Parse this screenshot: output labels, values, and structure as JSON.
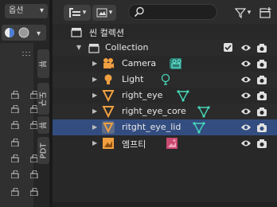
{
  "left_panel": {
    "options_label": "옵션",
    "tabs": [
      {
        "label": "뷰",
        "active": false
      },
      {
        "label": "도구",
        "active": false
      },
      {
        "label": "뷰",
        "active": false
      },
      {
        "label": "PDT",
        "active": false
      }
    ]
  },
  "outliner": {
    "scene_label": "씬 컬렉션",
    "rows": [
      {
        "name": "Collection",
        "type": "collection"
      },
      {
        "name": "Camera",
        "type": "camera"
      },
      {
        "name": "Light",
        "type": "light"
      },
      {
        "name": "right_eye",
        "type": "mesh"
      },
      {
        "name": "right_eye_core",
        "type": "mesh"
      },
      {
        "name": "ritght_eye_lid",
        "type": "mesh",
        "selected": true
      },
      {
        "name": "엠프티",
        "type": "empty"
      }
    ]
  },
  "colors": {
    "selection": "#334d80",
    "camera_data": "#43b8a6",
    "mesh_data": "#46d7b8",
    "object_orange": "#f0a040",
    "empty_pink": "#e06a8e"
  }
}
